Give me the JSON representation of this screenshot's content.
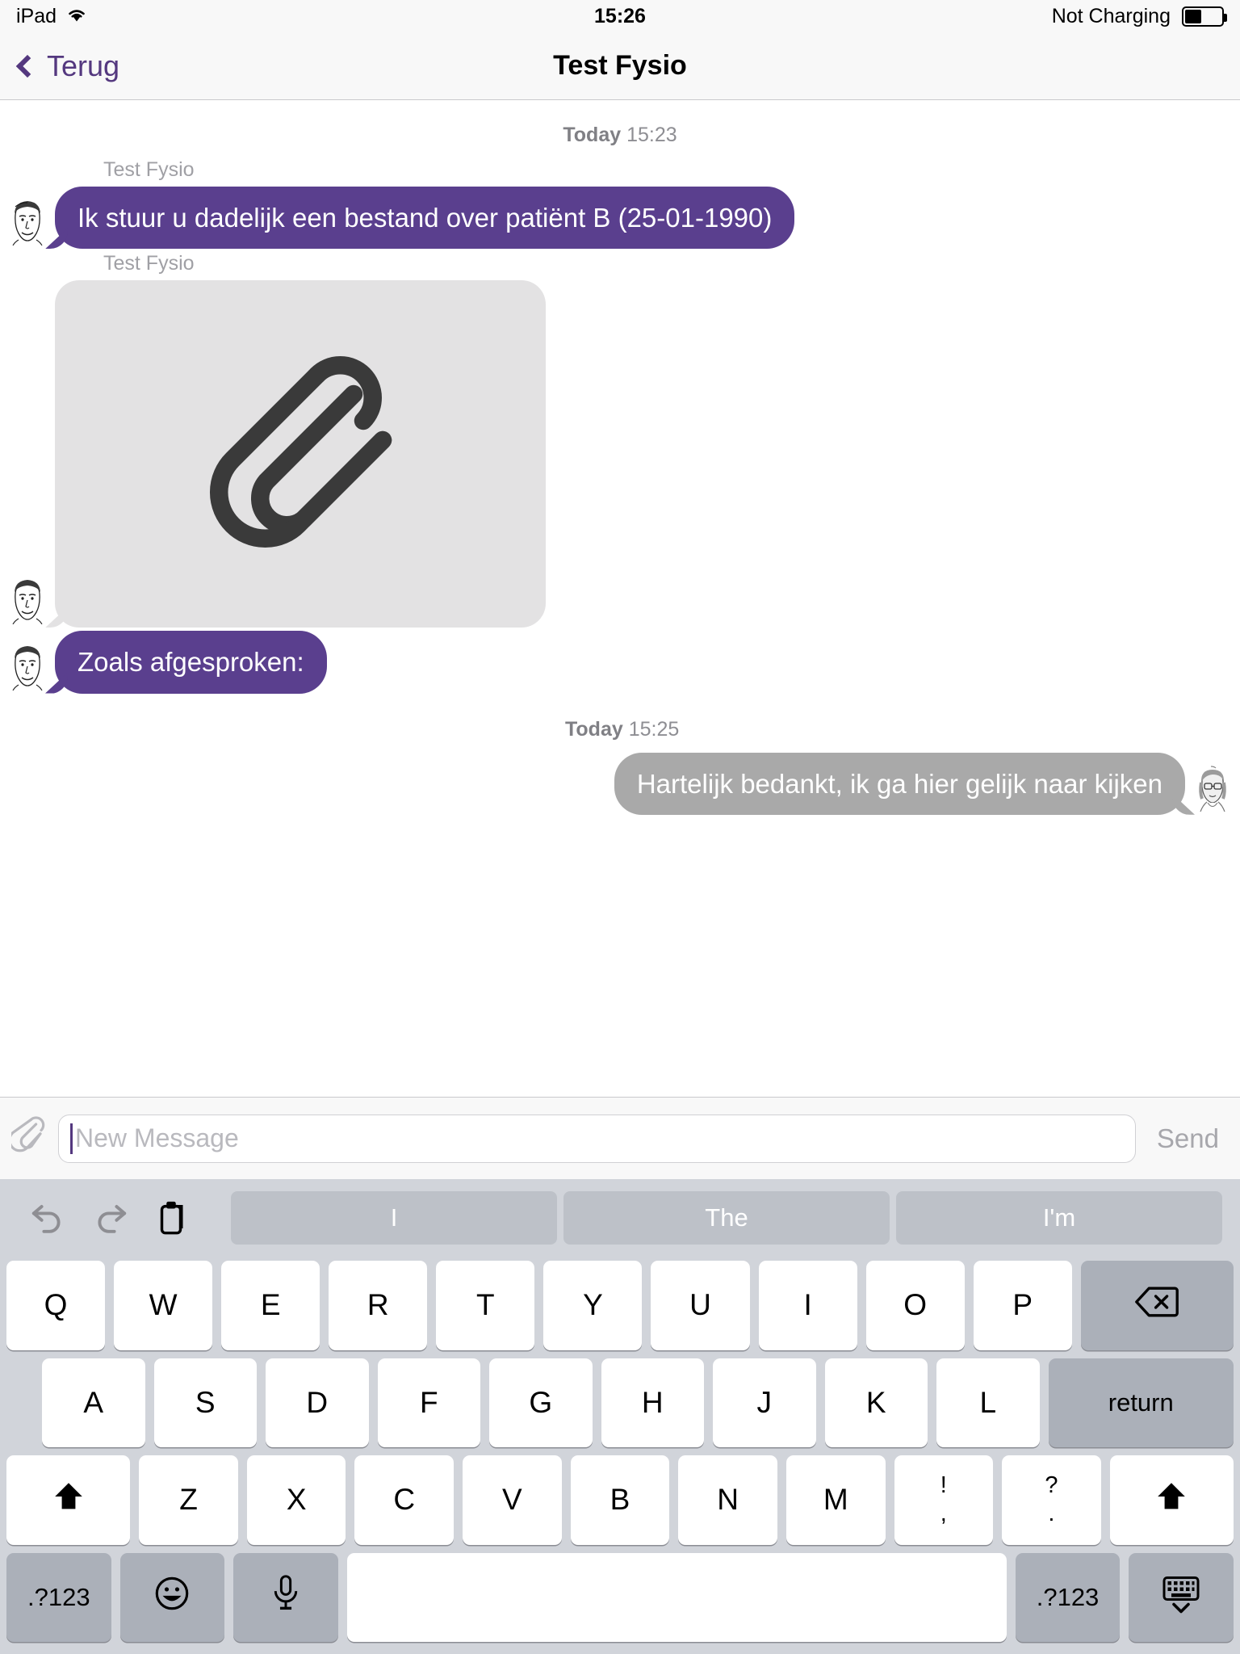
{
  "status_bar": {
    "device": "iPad",
    "wifi_icon": "wifi-icon",
    "time": "15:26",
    "charging_text": "Not Charging",
    "battery_icon": "battery-icon",
    "battery_level_pct": 45
  },
  "nav_bar": {
    "back_label": "Terug",
    "back_icon": "chevron-left-icon",
    "title": "Test Fysio",
    "accent_color": "#54387f"
  },
  "conversation": {
    "groups": [
      {
        "timestamp_day": "Today",
        "timestamp_time": "15:23",
        "align": "center"
      }
    ],
    "messages": [
      {
        "sender": "Test Fysio",
        "direction": "incoming",
        "type": "text",
        "text": "Ik stuur u dadelijk een bestand over patiënt B (25-01-1990)",
        "avatar": "male-avatar",
        "bubble_color": "#5a3f8e"
      },
      {
        "sender": "Test Fysio",
        "direction": "incoming",
        "type": "attachment",
        "attachment_icon": "paperclip-icon",
        "avatar": "male-avatar",
        "bubble_color": "#e3e2e3"
      },
      {
        "sender": "",
        "direction": "incoming",
        "type": "text",
        "text": "Zoals afgesproken:",
        "avatar": "male-avatar",
        "bubble_color": "#5a3f8e"
      },
      {
        "sender": "",
        "direction": "outgoing",
        "type": "text",
        "text": "Hartelijk bedankt, ik ga hier gelijk naar kijken",
        "avatar": "female-avatar",
        "bubble_color": "#a9a9a9"
      }
    ],
    "outgoing_timestamp_day": "Today",
    "outgoing_timestamp_time": "15:25"
  },
  "input_bar": {
    "attach_icon": "paperclip-icon",
    "placeholder": "New Message",
    "value": "",
    "send_label": "Send"
  },
  "keyboard": {
    "toolbar": {
      "undo_icon": "undo-arrow-icon",
      "redo_icon": "redo-arrow-icon",
      "paste_icon": "paste-clipboard-icon",
      "predictions": [
        "I",
        "The",
        "I'm"
      ]
    },
    "row1": [
      "Q",
      "W",
      "E",
      "R",
      "T",
      "Y",
      "U",
      "I",
      "O",
      "P"
    ],
    "row1_extra_label": "backspace-icon",
    "row2": [
      "A",
      "S",
      "D",
      "F",
      "G",
      "H",
      "J",
      "K",
      "L"
    ],
    "row2_extra_label": "return",
    "row3": [
      "Z",
      "X",
      "C",
      "V",
      "B",
      "N",
      "M"
    ],
    "row3_dual": [
      {
        "top": "!",
        "bot": ","
      },
      {
        "top": "?",
        "bot": "."
      }
    ],
    "shift_icon": "shift-arrow-icon",
    "row4": {
      "numbers_left": ".?123",
      "emoji_icon": "emoji-smiley-icon",
      "mic_icon": "microphone-icon",
      "space": "",
      "numbers_right": ".?123",
      "hide_icon": "hide-keyboard-icon"
    }
  }
}
